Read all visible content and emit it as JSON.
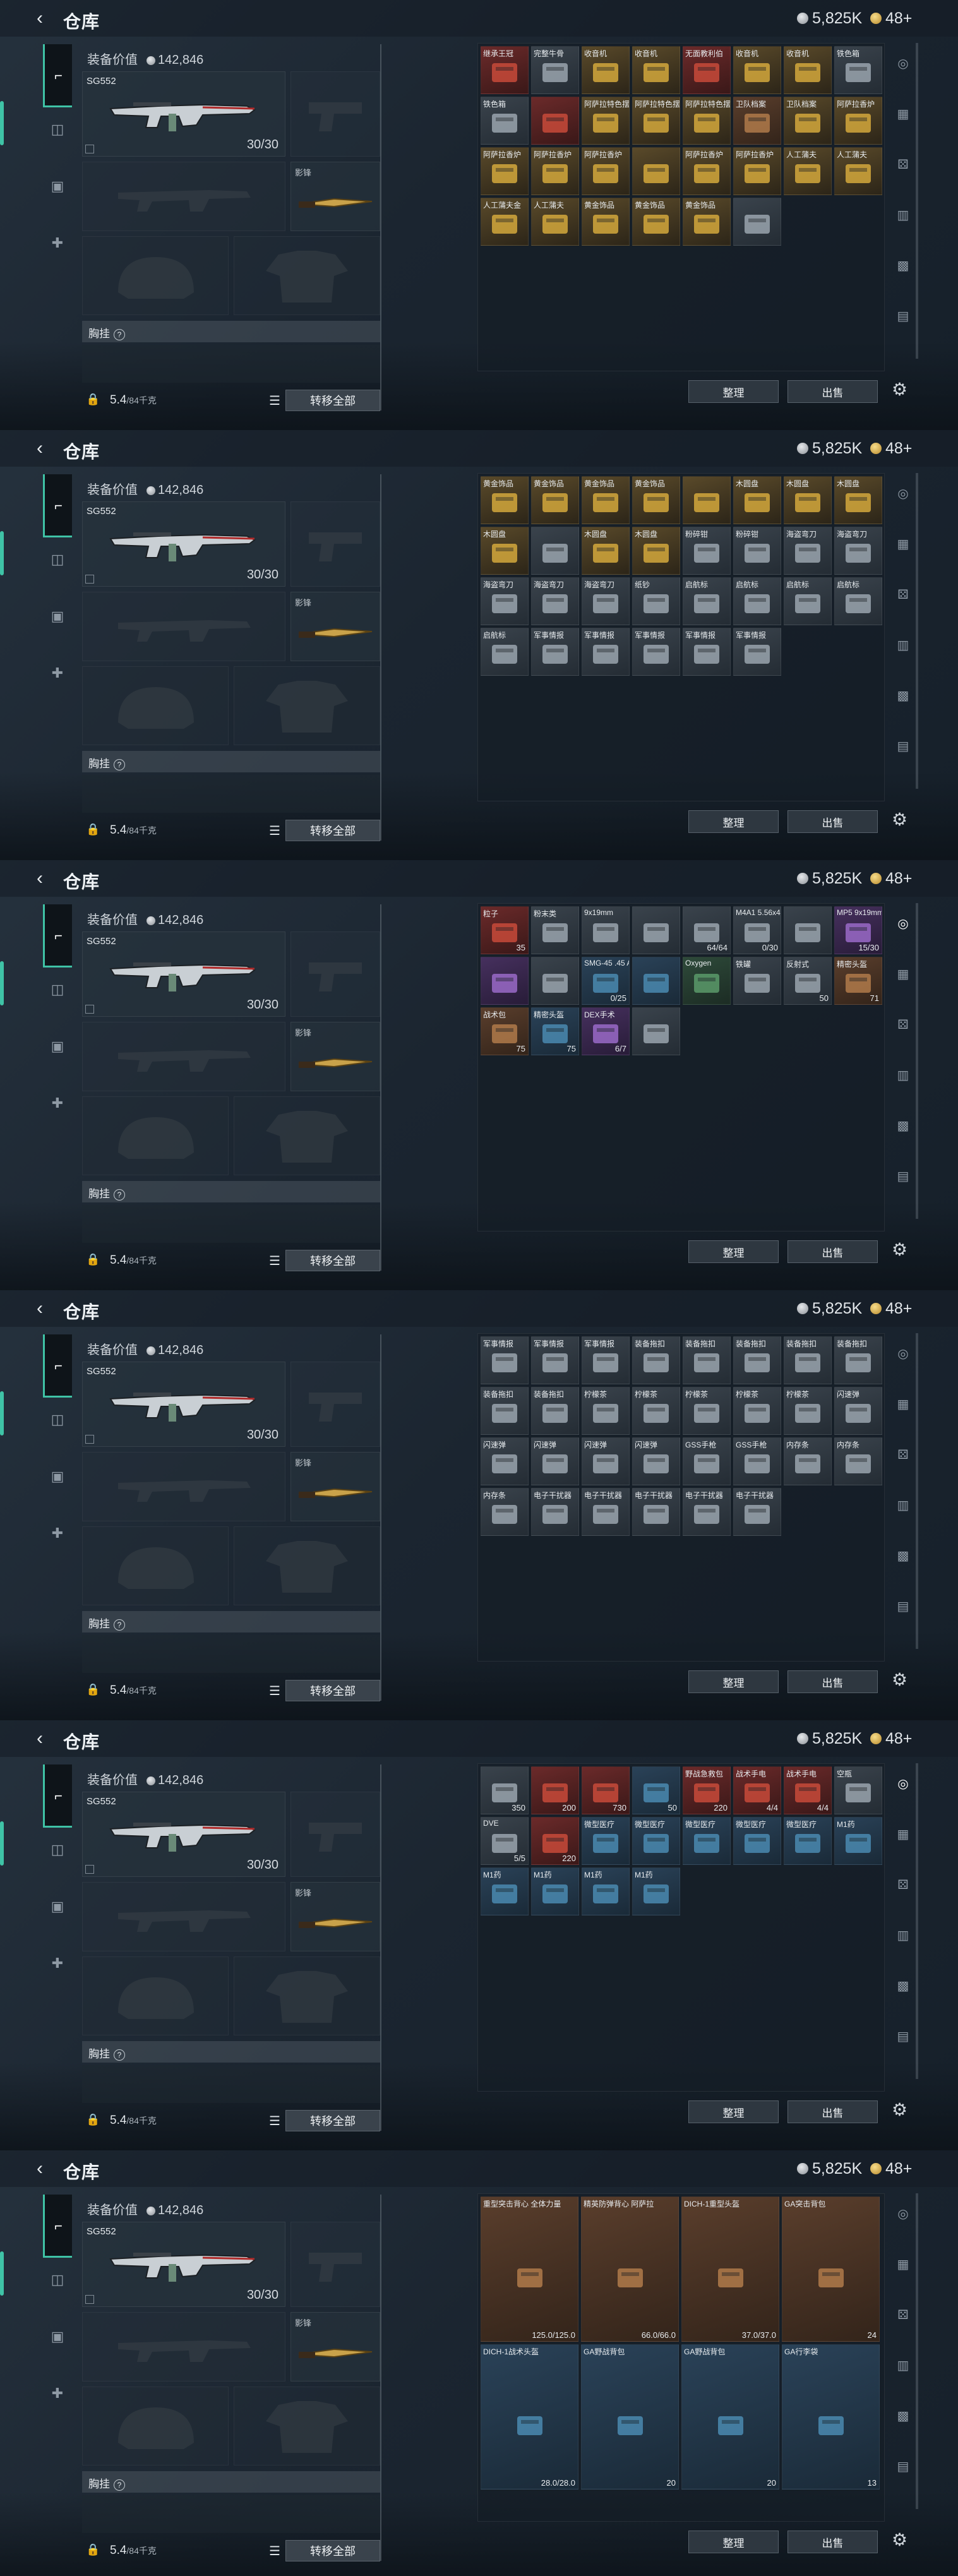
{
  "header": {
    "title": "仓库",
    "silver": "5,825K",
    "gold": "48+"
  },
  "loadout": {
    "equip_value_label": "装备价值",
    "equip_value": "142,846",
    "weapon_name": "SG552",
    "weapon_ammo": "30/30",
    "melee_label": "影锋",
    "rig_label": "胸挂",
    "weight": "5.4",
    "weight_cap": "/84千克",
    "transfer_all": "转移全部"
  },
  "stash_buttons": {
    "sort": "整理",
    "sell": "出售"
  },
  "icons": {
    "back": "back-arrow-icon",
    "settings": "gear-icon",
    "lock": "lock-icon",
    "list": "list-icon"
  },
  "panels": [
    {
      "cells": [
        {
          "nm": "继承王冠",
          "ct": "",
          "k": "red"
        },
        {
          "nm": "完整牛骨",
          "ct": "",
          "k": "grey"
        },
        {
          "nm": "收音机",
          "ct": "",
          "k": "gold"
        },
        {
          "nm": "收音机",
          "ct": "",
          "k": "gold"
        },
        {
          "nm": "无面教利伯",
          "ct": "",
          "k": "red"
        },
        {
          "nm": "收音机",
          "ct": "",
          "k": "gold"
        },
        {
          "nm": "收音机",
          "ct": "",
          "k": "gold"
        },
        {
          "nm": "铁色箱",
          "ct": "",
          "k": "grey"
        },
        {
          "nm": "铁色箱",
          "ct": "",
          "k": "grey"
        },
        {
          "nm": "",
          "ct": "",
          "k": "red"
        },
        {
          "nm": "阿萨拉特色摆件",
          "ct": "",
          "k": "gold"
        },
        {
          "nm": "阿萨拉特色摆件",
          "ct": "",
          "k": "gold"
        },
        {
          "nm": "阿萨拉特色摆件",
          "ct": "",
          "k": "gold"
        },
        {
          "nm": "卫队档案",
          "ct": "",
          "k": "brown"
        },
        {
          "nm": "卫队档案",
          "ct": "",
          "k": "gold"
        },
        {
          "nm": "阿萨拉香炉",
          "ct": "",
          "k": "gold"
        },
        {
          "nm": "阿萨拉香炉",
          "ct": "",
          "k": "gold"
        },
        {
          "nm": "阿萨拉香炉",
          "ct": "",
          "k": "gold"
        },
        {
          "nm": "阿萨拉香炉",
          "ct": "",
          "k": "gold"
        },
        {
          "nm": "",
          "ct": "",
          "k": "gold"
        },
        {
          "nm": "阿萨拉香炉",
          "ct": "",
          "k": "gold"
        },
        {
          "nm": "阿萨拉香炉",
          "ct": "",
          "k": "gold"
        },
        {
          "nm": "人工蒲夫",
          "ct": "",
          "k": "gold"
        },
        {
          "nm": "人工蒲夫",
          "ct": "",
          "k": "gold"
        },
        {
          "nm": "人工蒲夫金",
          "ct": "",
          "k": "gold"
        },
        {
          "nm": "人工蒲夫",
          "ct": "",
          "k": "gold"
        },
        {
          "nm": "黄金饰品",
          "ct": "",
          "k": "gold"
        },
        {
          "nm": "黄金饰品",
          "ct": "",
          "k": "gold"
        },
        {
          "nm": "黄金饰品",
          "ct": "",
          "k": "gold"
        },
        {
          "nm": "",
          "ct": "",
          "k": "grey"
        }
      ]
    },
    {
      "cells": [
        {
          "nm": "黄金饰品",
          "ct": "",
          "k": "gold"
        },
        {
          "nm": "黄金饰品",
          "ct": "",
          "k": "gold"
        },
        {
          "nm": "黄金饰品",
          "ct": "",
          "k": "gold"
        },
        {
          "nm": "黄金饰品",
          "ct": "",
          "k": "gold"
        },
        {
          "nm": "",
          "ct": "",
          "k": "gold"
        },
        {
          "nm": "木圆盘",
          "ct": "",
          "k": "gold"
        },
        {
          "nm": "木圆盘",
          "ct": "",
          "k": "gold"
        },
        {
          "nm": "木圆盘",
          "ct": "",
          "k": "gold"
        },
        {
          "nm": "木圆盘",
          "ct": "",
          "k": "gold"
        },
        {
          "nm": "",
          "ct": "",
          "k": "grey"
        },
        {
          "nm": "木圆盘",
          "ct": "",
          "k": "gold"
        },
        {
          "nm": "木圆盘",
          "ct": "",
          "k": "gold"
        },
        {
          "nm": "粉碎钳",
          "ct": "",
          "k": "grey"
        },
        {
          "nm": "粉碎钳",
          "ct": "",
          "k": "grey"
        },
        {
          "nm": "海盗弯刀",
          "ct": "",
          "k": "grey"
        },
        {
          "nm": "海盗弯刀",
          "ct": "",
          "k": "grey"
        },
        {
          "nm": "海盗弯刀",
          "ct": "",
          "k": "grey"
        },
        {
          "nm": "海盗弯刀",
          "ct": "",
          "k": "grey"
        },
        {
          "nm": "海盗弯刀",
          "ct": "",
          "k": "grey"
        },
        {
          "nm": "纸钞",
          "ct": "",
          "k": "grey"
        },
        {
          "nm": "启航标",
          "ct": "",
          "k": "grey"
        },
        {
          "nm": "启航标",
          "ct": "",
          "k": "grey"
        },
        {
          "nm": "启航标",
          "ct": "",
          "k": "grey"
        },
        {
          "nm": "启航标",
          "ct": "",
          "k": "grey"
        },
        {
          "nm": "启航标",
          "ct": "",
          "k": "grey"
        },
        {
          "nm": "军事情报",
          "ct": "",
          "k": "grey"
        },
        {
          "nm": "军事情报",
          "ct": "",
          "k": "grey"
        },
        {
          "nm": "军事情报",
          "ct": "",
          "k": "grey"
        },
        {
          "nm": "军事情报",
          "ct": "",
          "k": "grey"
        },
        {
          "nm": "军事情报",
          "ct": "",
          "k": "grey"
        }
      ]
    },
    {
      "cells": [
        {
          "nm": "粒子",
          "ct": "35",
          "k": "red"
        },
        {
          "nm": "粉末类",
          "ct": "",
          "k": "grey"
        },
        {
          "nm": "9x19mm",
          "ct": "",
          "k": "grey"
        },
        {
          "nm": "",
          "ct": "",
          "k": "grey"
        },
        {
          "nm": "",
          "ct": "64/64",
          "k": "grey"
        },
        {
          "nm": "M4A1 5.56x45mm",
          "ct": "0/30",
          "k": "grey"
        },
        {
          "nm": "",
          "ct": "",
          "k": "grey"
        },
        {
          "nm": "MP5 9x19mm",
          "ct": "15/30",
          "k": "purple"
        },
        {
          "nm": "",
          "ct": "",
          "k": "purple"
        },
        {
          "nm": "",
          "ct": "",
          "k": "grey"
        },
        {
          "nm": "SMG-45 .45 ACP",
          "ct": "0/25",
          "k": "blue"
        },
        {
          "nm": "",
          "ct": "",
          "k": "blue"
        },
        {
          "nm": "Oxygen",
          "ct": "",
          "k": "green"
        },
        {
          "nm": "铁罐",
          "ct": "",
          "k": "grey"
        },
        {
          "nm": "反射式",
          "ct": "50",
          "k": "grey"
        },
        {
          "nm": "精密头盔",
          "ct": "71",
          "k": "brown"
        },
        {
          "nm": "战术包",
          "ct": "75",
          "k": "brown"
        },
        {
          "nm": "精密头盔",
          "ct": "75",
          "k": "blue"
        },
        {
          "nm": "DEX手术",
          "ct": "6/7",
          "k": "purple"
        },
        {
          "nm": "",
          "ct": "",
          "k": "grey"
        }
      ]
    },
    {
      "cells": [
        {
          "nm": "军事情报",
          "ct": "",
          "k": "grey"
        },
        {
          "nm": "军事情报",
          "ct": "",
          "k": "grey"
        },
        {
          "nm": "军事情报",
          "ct": "",
          "k": "grey"
        },
        {
          "nm": "装备拖扣",
          "ct": "",
          "k": "grey"
        },
        {
          "nm": "装备拖扣",
          "ct": "",
          "k": "grey"
        },
        {
          "nm": "装备拖扣",
          "ct": "",
          "k": "grey"
        },
        {
          "nm": "装备拖扣",
          "ct": "",
          "k": "grey"
        },
        {
          "nm": "装备拖扣",
          "ct": "",
          "k": "grey"
        },
        {
          "nm": "装备拖扣",
          "ct": "",
          "k": "grey"
        },
        {
          "nm": "装备拖扣",
          "ct": "",
          "k": "grey"
        },
        {
          "nm": "柠檬茶",
          "ct": "",
          "k": "grey"
        },
        {
          "nm": "柠檬茶",
          "ct": "",
          "k": "grey"
        },
        {
          "nm": "柠檬茶",
          "ct": "",
          "k": "grey"
        },
        {
          "nm": "柠檬茶",
          "ct": "",
          "k": "grey"
        },
        {
          "nm": "柠檬茶",
          "ct": "",
          "k": "grey"
        },
        {
          "nm": "闪速弹",
          "ct": "",
          "k": "grey"
        },
        {
          "nm": "闪速弹",
          "ct": "",
          "k": "grey"
        },
        {
          "nm": "闪速弹",
          "ct": "",
          "k": "grey"
        },
        {
          "nm": "闪速弹",
          "ct": "",
          "k": "grey"
        },
        {
          "nm": "闪速弹",
          "ct": "",
          "k": "grey"
        },
        {
          "nm": "GSS手枪",
          "ct": "",
          "k": "grey"
        },
        {
          "nm": "GSS手枪",
          "ct": "",
          "k": "grey"
        },
        {
          "nm": "内存条",
          "ct": "",
          "k": "grey"
        },
        {
          "nm": "内存条",
          "ct": "",
          "k": "grey"
        },
        {
          "nm": "内存条",
          "ct": "",
          "k": "grey"
        },
        {
          "nm": "电子干扰器",
          "ct": "",
          "k": "grey"
        },
        {
          "nm": "电子干扰器",
          "ct": "",
          "k": "grey"
        },
        {
          "nm": "电子干扰器",
          "ct": "",
          "k": "grey"
        },
        {
          "nm": "电子干扰器",
          "ct": "",
          "k": "grey"
        },
        {
          "nm": "电子干扰器",
          "ct": "",
          "k": "grey"
        }
      ]
    },
    {
      "cells": [
        {
          "nm": "",
          "ct": "350",
          "k": "grey"
        },
        {
          "nm": "",
          "ct": "200",
          "k": "red"
        },
        {
          "nm": "",
          "ct": "730",
          "k": "red"
        },
        {
          "nm": "",
          "ct": "50",
          "k": "blue"
        },
        {
          "nm": "野战急救包",
          "ct": "220",
          "k": "red"
        },
        {
          "nm": "战术手电",
          "ct": "4/4",
          "k": "red"
        },
        {
          "nm": "战术手电",
          "ct": "4/4",
          "k": "red"
        },
        {
          "nm": "空瓶",
          "ct": "",
          "k": "grey"
        },
        {
          "nm": "DVE",
          "ct": "5/5",
          "k": "grey"
        },
        {
          "nm": "",
          "ct": "220",
          "k": "red"
        },
        {
          "nm": "微型医疗",
          "ct": "",
          "k": "blue"
        },
        {
          "nm": "微型医疗",
          "ct": "",
          "k": "blue"
        },
        {
          "nm": "微型医疗",
          "ct": "",
          "k": "blue"
        },
        {
          "nm": "微型医疗",
          "ct": "",
          "k": "blue"
        },
        {
          "nm": "微型医疗",
          "ct": "",
          "k": "blue"
        },
        {
          "nm": "M1药",
          "ct": "",
          "k": "blue"
        },
        {
          "nm": "M1药",
          "ct": "",
          "k": "blue"
        },
        {
          "nm": "M1药",
          "ct": "",
          "k": "blue"
        },
        {
          "nm": "M1药",
          "ct": "",
          "k": "blue"
        },
        {
          "nm": "M1药",
          "ct": "",
          "k": "blue"
        }
      ]
    },
    {
      "cells": [
        {
          "nm": "重型突击背心 全体力量",
          "ct": "125.0/125.0",
          "k": "brown"
        },
        {
          "nm": "精英防弹背心 阿萨拉",
          "ct": "66.0/66.0",
          "k": "brown"
        },
        {
          "nm": "DICH-1重型头盔",
          "ct": "37.0/37.0",
          "k": "brown"
        },
        {
          "nm": "GA突击背包",
          "ct": "24",
          "k": "brown"
        },
        {
          "nm": "DICH-1战术头盔",
          "ct": "28.0/28.0",
          "k": "blue"
        },
        {
          "nm": "GA野战背包",
          "ct": "20",
          "k": "blue"
        },
        {
          "nm": "GA野战背包",
          "ct": "20",
          "k": "blue"
        },
        {
          "nm": "GA行李袋",
          "ct": "13",
          "k": "blue"
        }
      ]
    }
  ]
}
